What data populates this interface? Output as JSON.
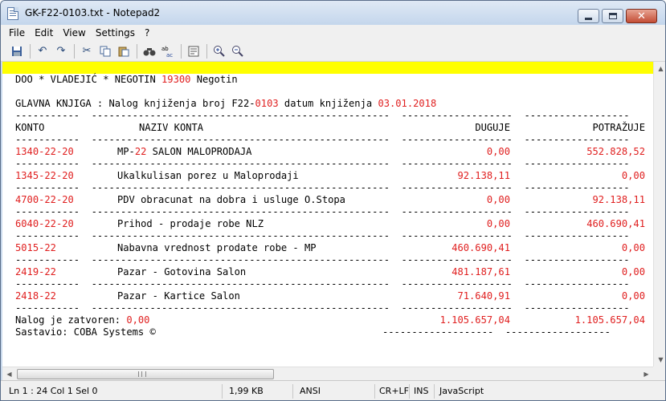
{
  "window": {
    "title": "GK-F22-0103.txt - Notepad2"
  },
  "menu": [
    "File",
    "Edit",
    "View",
    "Settings",
    "?"
  ],
  "toolbar": {
    "buttons": [
      "save-icon",
      "undo-icon",
      "redo-icon",
      "cut-icon",
      "copy-icon",
      "paste-icon",
      "find-icon",
      "replace-icon",
      "wordwrap-icon",
      "zoom-in-icon",
      "zoom-out-icon"
    ]
  },
  "doc": {
    "company_prefix": "DOO * VLADEJIĆ * NEGOTIN ",
    "company_zip": "19300",
    "company_city": " Negotin",
    "header_prefix": "GLAVNA KNJIGA : Nalog knjiženja broj F22-",
    "order_no": "0103",
    "date_label": " datum knjiženja ",
    "date": "03.01.2018",
    "col_konto": "KONTO",
    "col_naziv": "NAZIV KONTA",
    "col_duguje": "DUGUJE",
    "col_potrazuje": "POTRAŽUJE",
    "rows": [
      {
        "konto": "1340-22-20",
        "naziv_pre": "MP-",
        "naziv_red": "22",
        "naziv_post": " SALON MALOPRODAJA",
        "d_int": "0",
        "d_dec": ",00",
        "p_int": "552.828",
        "p_dec": ",52"
      },
      {
        "konto": "1345-22-20",
        "naziv_pre": "Ukalkulisan porez u Maloprodaji",
        "naziv_red": "",
        "naziv_post": "",
        "d_int": "92.138",
        "d_dec": ",11",
        "p_int": "0",
        "p_dec": ",00"
      },
      {
        "konto": "4700-22-20",
        "naziv_pre": "PDV obracunat na dobra i usluge O.Stopa",
        "naziv_red": "",
        "naziv_post": "",
        "d_int": "0",
        "d_dec": ",00",
        "p_int": "92.138",
        "p_dec": ",11"
      },
      {
        "konto": "6040-22-20",
        "naziv_pre": "Prihod - prodaje robe NLZ",
        "naziv_red": "",
        "naziv_post": "",
        "d_int": "0",
        "d_dec": ",00",
        "p_int": "460.690",
        "p_dec": ",41"
      },
      {
        "konto": "5015-22",
        "naziv_pre": "Nabavna vrednost prodate robe - MP",
        "naziv_red": "",
        "naziv_post": "",
        "d_int": "460.690",
        "d_dec": ",41",
        "p_int": "0",
        "p_dec": ",00"
      },
      {
        "konto": "2419-22",
        "naziv_pre": "Pazar - Gotovina Salon",
        "naziv_red": "",
        "naziv_post": "",
        "d_int": "481.187",
        "d_dec": ",61",
        "p_int": "0",
        "p_dec": ",00"
      },
      {
        "konto": "2418-22",
        "naziv_pre": "Pazar - Kartice Salon",
        "naziv_red": "",
        "naziv_post": "",
        "d_int": "71.640",
        "d_dec": ",91",
        "p_int": "0",
        "p_dec": ",00"
      }
    ],
    "closed_label": "Nalog je zatvoren: ",
    "closed_value": "0,00",
    "total_duguje_int": "1.105.657",
    "total_duguje_dec": ",04",
    "total_potrazuje_int": "1.105.657",
    "total_potrazuje_dec": ",04",
    "footer": "Sastavio: COBA Systems ©"
  },
  "status": {
    "position": "Ln 1 : 24   Col 1   Sel 0",
    "size": "1,99 KB",
    "encoding": "ANSI",
    "eol": "CR+LF",
    "mode": "INS",
    "lexer": "JavaScript"
  },
  "colors": {
    "highlight": "#ffff00",
    "red_text": "#e02020"
  }
}
